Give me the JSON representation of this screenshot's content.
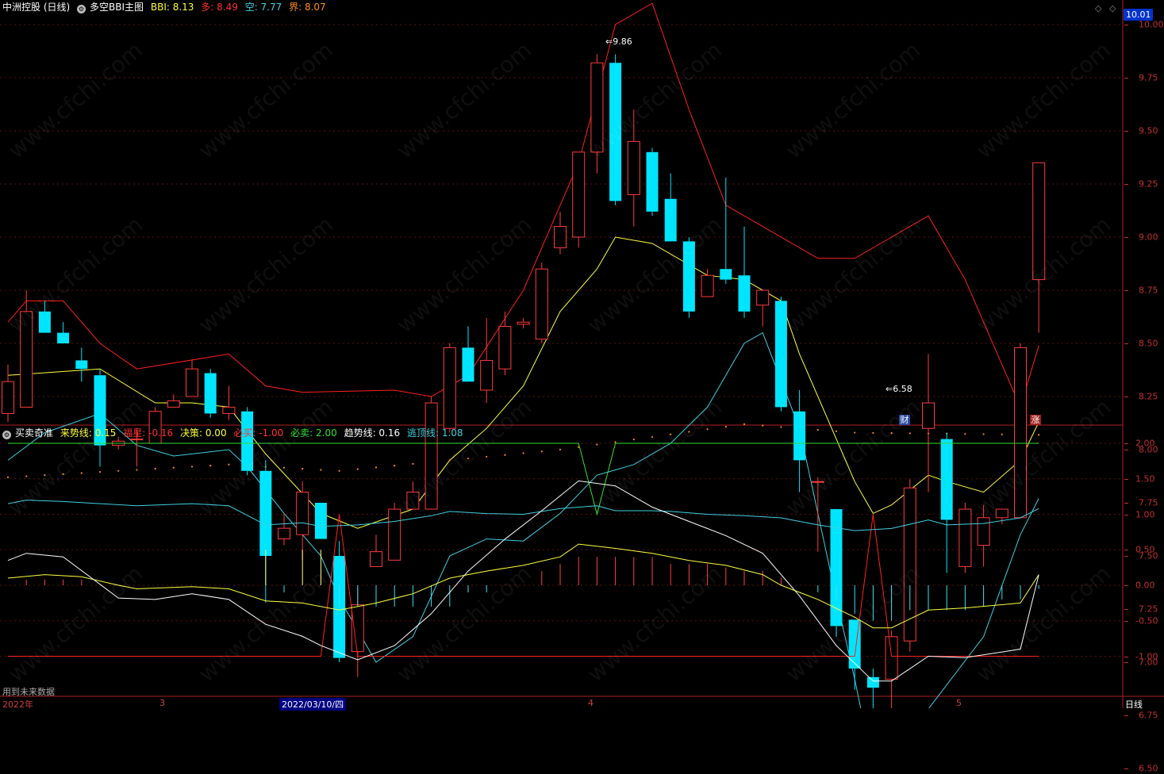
{
  "main_header": {
    "stock_name": "中洲控股 (日线)",
    "indicator_name": "多空BBI主图",
    "bbi": "BBI: 8.13",
    "duo": "多: 8.49",
    "kong": "空: 7.77",
    "jie": "界: 8.07"
  },
  "sub_header": {
    "indicator_name": "买卖奇准",
    "laishi": "来势线: 0.15",
    "fuxing": "福星: -0.16",
    "juece": "决策: 0.00",
    "bimai": "必买: -1.00",
    "bimai2": "必卖: 2.00",
    "qushi": "趋势线: 0.16",
    "taoding": "逃顶线: 1.08"
  },
  "current_price": "10.01",
  "main_axis_ticks": [
    "10.00",
    "9.75",
    "9.50",
    "9.25",
    "9.00",
    "8.75",
    "8.50",
    "8.25",
    "8.00",
    "7.75",
    "7.50",
    "7.25",
    "7.00",
    "6.75",
    "6.50"
  ],
  "sub_axis_ticks": [
    "2.00",
    "1.50",
    "1.00",
    "0.50",
    "0.00",
    "-0.50",
    "-1.00"
  ],
  "annotations": {
    "high": "9.86",
    "low": "6.58"
  },
  "badges": {
    "cai": "财",
    "zhang": "涨"
  },
  "dates": {
    "year": "2022年",
    "m3": "3",
    "d0310": "2022/03/10/四",
    "m4": "4",
    "m5": "5"
  },
  "period_label": "日线",
  "bottom_note": "用到未来数据",
  "watermark": "www.cfchi.com",
  "colors": {
    "up": "#ff3b3b",
    "down": "#00e5ff",
    "bbi": "#ffff40",
    "duo": "#ff2020",
    "kong": "#40d0e0",
    "jie": "#ff8c1a"
  },
  "chart_data": {
    "type": "candlestick",
    "candles": [
      {
        "o": 8.17,
        "h": 8.4,
        "l": 8.13,
        "c": 8.32
      },
      {
        "o": 8.2,
        "h": 8.75,
        "l": 8.2,
        "c": 8.65
      },
      {
        "o": 8.65,
        "h": 8.7,
        "l": 8.55,
        "c": 8.55
      },
      {
        "o": 8.55,
        "h": 8.6,
        "l": 8.5,
        "c": 8.5
      },
      {
        "o": 8.42,
        "h": 8.48,
        "l": 8.32,
        "c": 8.38
      },
      {
        "o": 8.35,
        "h": 8.38,
        "l": 7.92,
        "c": 8.02
      },
      {
        "o": 8.02,
        "h": 8.06,
        "l": 8.0,
        "c": 8.04
      },
      {
        "o": 8.05,
        "h": 8.1,
        "l": 7.92,
        "c": 8.05
      },
      {
        "o": 8.03,
        "h": 8.2,
        "l": 8.03,
        "c": 8.18
      },
      {
        "o": 8.2,
        "h": 8.26,
        "l": 8.2,
        "c": 8.23
      },
      {
        "o": 8.25,
        "h": 8.42,
        "l": 8.25,
        "c": 8.38
      },
      {
        "o": 8.36,
        "h": 8.38,
        "l": 8.15,
        "c": 8.17
      },
      {
        "o": 8.17,
        "h": 8.3,
        "l": 8.14,
        "c": 8.2
      },
      {
        "o": 8.18,
        "h": 8.2,
        "l": 7.88,
        "c": 7.9
      },
      {
        "o": 7.9,
        "h": 7.95,
        "l": 7.28,
        "c": 7.5
      },
      {
        "o": 7.58,
        "h": 7.7,
        "l": 7.55,
        "c": 7.63
      },
      {
        "o": 7.6,
        "h": 7.85,
        "l": 7.48,
        "c": 7.8
      },
      {
        "o": 7.75,
        "h": 7.75,
        "l": 7.58,
        "c": 7.58
      },
      {
        "o": 7.5,
        "h": 7.57,
        "l": 7.0,
        "c": 7.02
      },
      {
        "o": 7.05,
        "h": 7.35,
        "l": 6.93,
        "c": 7.27
      },
      {
        "o": 7.45,
        "h": 7.6,
        "l": 7.45,
        "c": 7.52
      },
      {
        "o": 7.48,
        "h": 7.75,
        "l": 7.48,
        "c": 7.72
      },
      {
        "o": 7.72,
        "h": 7.85,
        "l": 7.72,
        "c": 7.8
      },
      {
        "o": 7.72,
        "h": 8.25,
        "l": 7.72,
        "c": 8.22
      },
      {
        "o": 8.1,
        "h": 8.5,
        "l": 8.08,
        "c": 8.48
      },
      {
        "o": 8.48,
        "h": 8.58,
        "l": 8.32,
        "c": 8.32
      },
      {
        "o": 8.28,
        "h": 8.62,
        "l": 8.22,
        "c": 8.42
      },
      {
        "o": 8.38,
        "h": 8.65,
        "l": 8.35,
        "c": 8.58
      },
      {
        "o": 8.59,
        "h": 8.62,
        "l": 8.57,
        "c": 8.6
      },
      {
        "o": 8.52,
        "h": 8.88,
        "l": 8.5,
        "c": 8.85
      },
      {
        "o": 8.95,
        "h": 9.12,
        "l": 8.92,
        "c": 9.05
      },
      {
        "o": 9.0,
        "h": 9.4,
        "l": 8.95,
        "c": 9.4
      },
      {
        "o": 9.4,
        "h": 9.86,
        "l": 9.3,
        "c": 9.82
      },
      {
        "o": 9.82,
        "h": 9.86,
        "l": 9.15,
        "c": 9.17
      },
      {
        "o": 9.2,
        "h": 9.6,
        "l": 9.05,
        "c": 9.45
      },
      {
        "o": 9.4,
        "h": 9.42,
        "l": 9.1,
        "c": 9.12
      },
      {
        "o": 9.18,
        "h": 9.3,
        "l": 8.98,
        "c": 8.98
      },
      {
        "o": 8.98,
        "h": 9.0,
        "l": 8.62,
        "c": 8.65
      },
      {
        "o": 8.72,
        "h": 8.85,
        "l": 8.72,
        "c": 8.82
      },
      {
        "o": 8.85,
        "h": 9.28,
        "l": 8.78,
        "c": 8.8
      },
      {
        "o": 8.82,
        "h": 9.05,
        "l": 8.62,
        "c": 8.65
      },
      {
        "o": 8.68,
        "h": 8.75,
        "l": 8.58,
        "c": 8.75
      },
      {
        "o": 8.7,
        "h": 8.72,
        "l": 8.18,
        "c": 8.2
      },
      {
        "o": 8.18,
        "h": 8.28,
        "l": 7.8,
        "c": 7.95
      },
      {
        "o": 7.85,
        "h": 7.87,
        "l": 7.52,
        "c": 7.85
      },
      {
        "o": 7.72,
        "h": 7.72,
        "l": 7.12,
        "c": 7.17
      },
      {
        "o": 7.2,
        "h": 7.2,
        "l": 6.87,
        "c": 6.97
      },
      {
        "o": 6.93,
        "h": 6.97,
        "l": 6.58,
        "c": 6.88
      },
      {
        "o": 6.92,
        "h": 7.15,
        "l": 6.78,
        "c": 7.12
      },
      {
        "o": 7.1,
        "h": 7.86,
        "l": 7.05,
        "c": 7.82
      },
      {
        "o": 8.1,
        "h": 8.45,
        "l": 7.8,
        "c": 8.22
      },
      {
        "o": 8.05,
        "h": 8.08,
        "l": 7.42,
        "c": 7.67
      },
      {
        "o": 7.45,
        "h": 7.75,
        "l": 7.42,
        "c": 7.72
      },
      {
        "o": 7.55,
        "h": 7.74,
        "l": 7.45,
        "c": 7.68
      },
      {
        "o": 7.68,
        "h": 7.72,
        "l": 7.65,
        "c": 7.72
      },
      {
        "o": 7.68,
        "h": 8.5,
        "l": 7.68,
        "c": 8.48
      },
      {
        "o": 8.8,
        "h": 9.35,
        "l": 8.55,
        "c": 9.35
      }
    ],
    "bbi": [
      {
        "i": 0,
        "v": 8.35
      },
      {
        "i": 5,
        "v": 8.38
      },
      {
        "i": 8,
        "v": 8.22
      },
      {
        "i": 10,
        "v": 8.22
      },
      {
        "i": 12,
        "v": 8.2
      },
      {
        "i": 14,
        "v": 7.98
      },
      {
        "i": 17,
        "v": 7.7
      },
      {
        "i": 19,
        "v": 7.63
      },
      {
        "i": 22,
        "v": 7.72
      },
      {
        "i": 24,
        "v": 7.95
      },
      {
        "i": 26,
        "v": 8.1
      },
      {
        "i": 28,
        "v": 8.3
      },
      {
        "i": 30,
        "v": 8.65
      },
      {
        "i": 32,
        "v": 8.85
      },
      {
        "i": 33,
        "v": 9.0
      },
      {
        "i": 35,
        "v": 8.97
      },
      {
        "i": 38,
        "v": 8.82
      },
      {
        "i": 40,
        "v": 8.8
      },
      {
        "i": 42,
        "v": 8.7
      },
      {
        "i": 43,
        "v": 8.45
      },
      {
        "i": 46,
        "v": 7.85
      },
      {
        "i": 47,
        "v": 7.7
      },
      {
        "i": 48,
        "v": 7.74
      },
      {
        "i": 50,
        "v": 7.88
      },
      {
        "i": 51,
        "v": 7.85
      },
      {
        "i": 53,
        "v": 7.8
      },
      {
        "i": 55,
        "v": 7.95
      },
      {
        "i": 56,
        "v": 8.13
      }
    ],
    "duo": [
      {
        "i": 0,
        "v": 8.6
      },
      {
        "i": 1,
        "v": 8.7
      },
      {
        "i": 3,
        "v": 8.7
      },
      {
        "i": 5,
        "v": 8.5
      },
      {
        "i": 7,
        "v": 8.38
      },
      {
        "i": 12,
        "v": 8.45
      },
      {
        "i": 14,
        "v": 8.3
      },
      {
        "i": 16,
        "v": 8.27
      },
      {
        "i": 21,
        "v": 8.28
      },
      {
        "i": 23,
        "v": 8.25
      },
      {
        "i": 25,
        "v": 8.35
      },
      {
        "i": 28,
        "v": 8.75
      },
      {
        "i": 31,
        "v": 9.35
      },
      {
        "i": 33,
        "v": 10.0
      },
      {
        "i": 35,
        "v": 10.1
      },
      {
        "i": 37,
        "v": 9.6
      },
      {
        "i": 39,
        "v": 9.15
      },
      {
        "i": 41,
        "v": 9.05
      },
      {
        "i": 44,
        "v": 8.9
      },
      {
        "i": 46,
        "v": 8.9
      },
      {
        "i": 48,
        "v": 9.0
      },
      {
        "i": 50,
        "v": 9.1
      },
      {
        "i": 52,
        "v": 8.8
      },
      {
        "i": 55,
        "v": 8.2
      },
      {
        "i": 56,
        "v": 8.49
      }
    ],
    "kong": [
      {
        "i": 0,
        "v": 7.95
      },
      {
        "i": 2,
        "v": 8.08
      },
      {
        "i": 5,
        "v": 8.17
      },
      {
        "i": 7,
        "v": 8.02
      },
      {
        "i": 9,
        "v": 7.97
      },
      {
        "i": 12,
        "v": 8.0
      },
      {
        "i": 13,
        "v": 7.92
      },
      {
        "i": 15,
        "v": 7.7
      },
      {
        "i": 17,
        "v": 7.5
      },
      {
        "i": 18,
        "v": 7.3
      },
      {
        "i": 20,
        "v": 7.0
      },
      {
        "i": 22,
        "v": 7.12
      },
      {
        "i": 24,
        "v": 7.5
      },
      {
        "i": 26,
        "v": 7.58
      },
      {
        "i": 28,
        "v": 7.57
      },
      {
        "i": 30,
        "v": 7.7
      },
      {
        "i": 32,
        "v": 7.88
      },
      {
        "i": 34,
        "v": 7.93
      },
      {
        "i": 36,
        "v": 8.03
      },
      {
        "i": 38,
        "v": 8.2
      },
      {
        "i": 40,
        "v": 8.5
      },
      {
        "i": 41,
        "v": 8.55
      },
      {
        "i": 43,
        "v": 8.1
      },
      {
        "i": 45,
        "v": 7.3
      },
      {
        "i": 46,
        "v": 6.92
      },
      {
        "i": 47,
        "v": 6.5
      },
      {
        "i": 48,
        "v": 6.45
      },
      {
        "i": 50,
        "v": 6.78
      },
      {
        "i": 53,
        "v": 7.12
      },
      {
        "i": 55,
        "v": 7.6
      },
      {
        "i": 56,
        "v": 7.77
      }
    ],
    "jie": [
      {
        "i": 0,
        "v": 7.87
      },
      {
        "i": 12,
        "v": 7.93
      },
      {
        "i": 18,
        "v": 7.9
      },
      {
        "i": 30,
        "v": 8.0
      },
      {
        "i": 40,
        "v": 8.12
      },
      {
        "i": 46,
        "v": 8.08
      },
      {
        "i": 56,
        "v": 8.07
      }
    ],
    "sub": {
      "taoding": [
        {
          "i": 0,
          "v": 1.15
        },
        {
          "i": 1,
          "v": 1.2
        },
        {
          "i": 3,
          "v": 1.18
        },
        {
          "i": 5,
          "v": 1.15
        },
        {
          "i": 7,
          "v": 1.12
        },
        {
          "i": 10,
          "v": 1.15
        },
        {
          "i": 12,
          "v": 1.12
        },
        {
          "i": 14,
          "v": 0.85
        },
        {
          "i": 16,
          "v": 0.88
        },
        {
          "i": 17,
          "v": 0.83
        },
        {
          "i": 19,
          "v": 0.85
        },
        {
          "i": 21,
          "v": 0.9
        },
        {
          "i": 23,
          "v": 0.98
        },
        {
          "i": 24,
          "v": 1.04
        },
        {
          "i": 26,
          "v": 1.01
        },
        {
          "i": 28,
          "v": 1.0
        },
        {
          "i": 30,
          "v": 1.08
        },
        {
          "i": 32,
          "v": 1.12
        },
        {
          "i": 33,
          "v": 1.05
        },
        {
          "i": 35,
          "v": 1.05
        },
        {
          "i": 36,
          "v": 1.04
        },
        {
          "i": 38,
          "v": 1.0
        },
        {
          "i": 40,
          "v": 0.98
        },
        {
          "i": 42,
          "v": 0.95
        },
        {
          "i": 44,
          "v": 0.85
        },
        {
          "i": 46,
          "v": 0.77
        },
        {
          "i": 48,
          "v": 0.8
        },
        {
          "i": 50,
          "v": 0.92
        },
        {
          "i": 51,
          "v": 0.85
        },
        {
          "i": 53,
          "v": 0.87
        },
        {
          "i": 55,
          "v": 0.95
        },
        {
          "i": 56,
          "v": 1.08
        }
      ],
      "laishi": [
        {
          "i": 0,
          "v": 0.1
        },
        {
          "i": 2,
          "v": 0.15
        },
        {
          "i": 4,
          "v": 0.12
        },
        {
          "i": 6,
          "v": 0.0
        },
        {
          "i": 7,
          "v": -0.05
        },
        {
          "i": 10,
          "v": -0.02
        },
        {
          "i": 12,
          "v": -0.05
        },
        {
          "i": 14,
          "v": -0.22
        },
        {
          "i": 16,
          "v": -0.25
        },
        {
          "i": 18,
          "v": -0.35
        },
        {
          "i": 20,
          "v": -0.25
        },
        {
          "i": 22,
          "v": -0.12
        },
        {
          "i": 24,
          "v": 0.1
        },
        {
          "i": 26,
          "v": 0.2
        },
        {
          "i": 28,
          "v": 0.28
        },
        {
          "i": 30,
          "v": 0.4
        },
        {
          "i": 31,
          "v": 0.58
        },
        {
          "i": 33,
          "v": 0.52
        },
        {
          "i": 35,
          "v": 0.45
        },
        {
          "i": 37,
          "v": 0.35
        },
        {
          "i": 39,
          "v": 0.28
        },
        {
          "i": 41,
          "v": 0.15
        },
        {
          "i": 42,
          "v": 0.0
        },
        {
          "i": 44,
          "v": -0.2
        },
        {
          "i": 46,
          "v": -0.45
        },
        {
          "i": 47,
          "v": -0.6
        },
        {
          "i": 48,
          "v": -0.6
        },
        {
          "i": 50,
          "v": -0.35
        },
        {
          "i": 52,
          "v": -0.32
        },
        {
          "i": 55,
          "v": -0.25
        },
        {
          "i": 56,
          "v": 0.15
        }
      ],
      "fuxing": [
        {
          "i": 0,
          "v": 0.35
        },
        {
          "i": 1,
          "v": 0.45
        },
        {
          "i": 3,
          "v": 0.4
        },
        {
          "i": 6,
          "v": -0.18
        },
        {
          "i": 8,
          "v": -0.2
        },
        {
          "i": 10,
          "v": -0.12
        },
        {
          "i": 12,
          "v": -0.2
        },
        {
          "i": 14,
          "v": -0.55
        },
        {
          "i": 16,
          "v": -0.72
        },
        {
          "i": 17,
          "v": -0.85
        },
        {
          "i": 19,
          "v": -1.05
        },
        {
          "i": 21,
          "v": -0.85
        },
        {
          "i": 23,
          "v": -0.4
        },
        {
          "i": 25,
          "v": 0.2
        },
        {
          "i": 27,
          "v": 0.65
        },
        {
          "i": 29,
          "v": 1.05
        },
        {
          "i": 31,
          "v": 1.47
        },
        {
          "i": 33,
          "v": 1.4
        },
        {
          "i": 35,
          "v": 1.1
        },
        {
          "i": 37,
          "v": 0.9
        },
        {
          "i": 39,
          "v": 0.7
        },
        {
          "i": 41,
          "v": 0.45
        },
        {
          "i": 43,
          "v": -0.15
        },
        {
          "i": 45,
          "v": -0.85
        },
        {
          "i": 47,
          "v": -1.35
        },
        {
          "i": 48,
          "v": -1.35
        },
        {
          "i": 50,
          "v": -1.0
        },
        {
          "i": 52,
          "v": -1.02
        },
        {
          "i": 55,
          "v": -0.9
        },
        {
          "i": 56,
          "v": 0.15
        }
      ],
      "bimai_mai": [
        {
          "i": 0,
          "v": -1.0
        },
        {
          "i": 17,
          "v": -1.0
        },
        {
          "i": 18,
          "v": 1.0
        },
        {
          "i": 19,
          "v": -1.0
        },
        {
          "i": 46,
          "v": -1.0
        },
        {
          "i": 47,
          "v": 1.0
        },
        {
          "i": 48,
          "v": -1.0
        },
        {
          "i": 56,
          "v": -1.0
        }
      ],
      "bimai_sell": [
        {
          "i": 0,
          "v": 2.0
        },
        {
          "i": 31,
          "v": 2.0
        },
        {
          "i": 32,
          "v": 1.0
        },
        {
          "i": 33,
          "v": 2.0
        },
        {
          "i": 56,
          "v": 2.0
        }
      ],
      "bars": [
        0,
        0.08,
        0.08,
        0.08,
        0.08,
        0,
        0,
        0,
        0,
        0,
        0,
        0,
        0,
        0,
        0.5,
        -0.1,
        0.5,
        0.5,
        -0.3,
        -0.3,
        -0.3,
        -0.3,
        -0.3,
        -0.3,
        -0.3,
        -0.1,
        -0.1,
        0,
        0,
        0.2,
        0.3,
        0.4,
        0.4,
        0.4,
        0.4,
        0.4,
        0.3,
        0.3,
        0.3,
        0.25,
        0.2,
        0.2,
        0.1,
        0,
        -0.1,
        -0.2,
        -0.4,
        -0.5,
        -0.5,
        -0.35,
        -0.35,
        -0.35,
        -0.35,
        -0.3,
        -0.2,
        -0.2,
        -0.05
      ]
    }
  }
}
